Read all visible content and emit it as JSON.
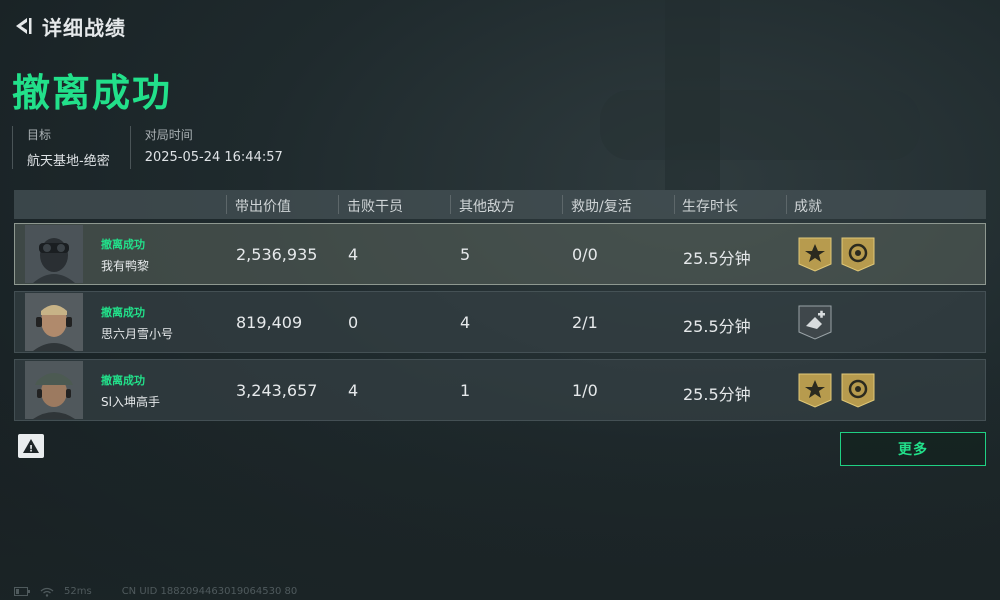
{
  "header": {
    "title": "详细战绩",
    "result": "撤离成功"
  },
  "meta": {
    "target_label": "目标",
    "target_value": "航天基地-绝密",
    "time_label": "对局时间",
    "time_value": "2025-05-24 16:44:57"
  },
  "table": {
    "columns": [
      "带出价值",
      "击败干员",
      "其他敌方",
      "救助/复活",
      "生存时长",
      "成就"
    ],
    "rows": [
      {
        "status": "撤离成功",
        "name": "我有鸭黎",
        "value": "2,536,935",
        "kills": "4",
        "others": "5",
        "assist": "0/0",
        "survival": "25.5分钟",
        "badges": [
          "gold-star-badge",
          "gold-emblem-badge"
        ]
      },
      {
        "status": "撤离成功",
        "name": "思六月雪小号",
        "value": "819,409",
        "kills": "0",
        "others": "4",
        "assist": "2/1",
        "survival": "25.5分钟",
        "badges": [
          "silver-medic-badge"
        ]
      },
      {
        "status": "撤离成功",
        "name": "Sl入坤高手",
        "value": "3,243,657",
        "kills": "4",
        "others": "1",
        "assist": "1/0",
        "survival": "25.5分钟",
        "badges": [
          "gold-star-badge",
          "gold-emblem-badge"
        ]
      }
    ]
  },
  "actions": {
    "more_label": "更多",
    "warning_glyph": "!"
  },
  "footer": {
    "ping": "52ms",
    "uid": "CN UID 1882094463019064530 80"
  },
  "colors": {
    "accent_green": "#22e08a",
    "badge_gold": "#b79b4e"
  }
}
